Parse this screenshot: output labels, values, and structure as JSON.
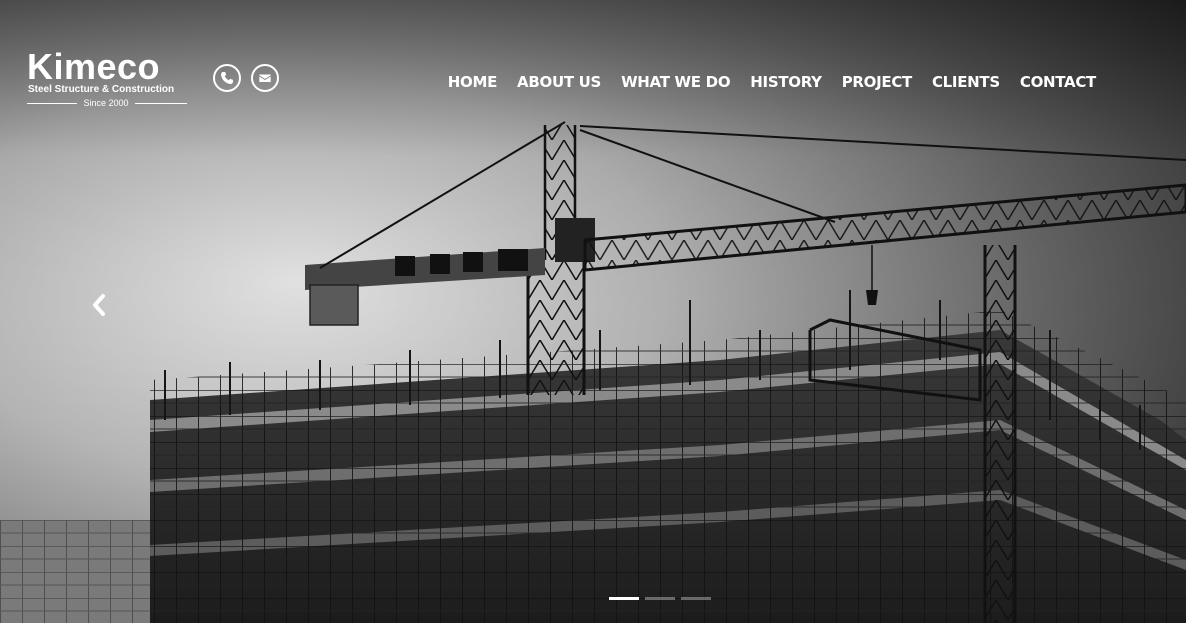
{
  "brand": {
    "name": "Kimeco",
    "tagline": "Steel Structure & Construction",
    "since": "Since 2000"
  },
  "contact_icons": [
    "phone-icon",
    "envelope-icon"
  ],
  "nav": {
    "items": [
      {
        "label": "HOME"
      },
      {
        "label": "ABOUT US"
      },
      {
        "label": "WHAT WE DO"
      },
      {
        "label": "HISTORY"
      },
      {
        "label": "PROJECT"
      },
      {
        "label": "CLIENTS"
      },
      {
        "label": "CONTACT"
      }
    ]
  },
  "carousel": {
    "slide_count": 3,
    "active_index": 0,
    "prev_icon": "chevron-left-icon"
  },
  "colors": {
    "text": "#ffffff",
    "overlay": "#2a2a2a"
  }
}
